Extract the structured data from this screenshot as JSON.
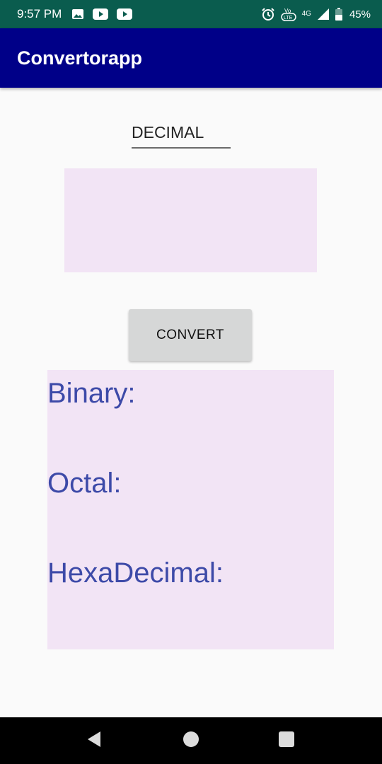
{
  "status_bar": {
    "time": "9:57 PM",
    "network": "4G",
    "battery": "45%",
    "icons": [
      "image-icon",
      "youtube-icon",
      "youtube-icon",
      "alarm-icon",
      "volte-icon",
      "signal-icon",
      "battery-icon"
    ]
  },
  "app_bar": {
    "title": "Convertorapp",
    "color": "#000088"
  },
  "decimal_field": {
    "placeholder": "DECIMAL",
    "value": ""
  },
  "convert_button": {
    "label": "CONVERT"
  },
  "results": {
    "binary_label": "Binary:",
    "octal_label": "Octal:",
    "hexadecimal_label": "HexaDecimal:"
  },
  "colors": {
    "status_bar": "#0a5c4e",
    "panel": "#f2e4f5",
    "result_text": "#3d4aa8",
    "button": "#d6d7d7"
  },
  "nav_bar": {
    "icons": [
      "back-icon",
      "home-icon",
      "recents-icon"
    ]
  }
}
